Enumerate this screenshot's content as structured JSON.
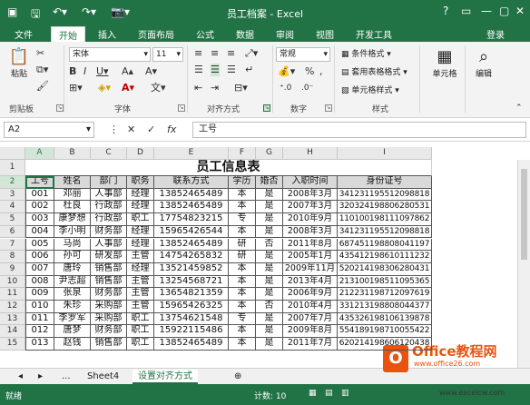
{
  "window": {
    "title": "员工档案 - Excel"
  },
  "ribbon_tabs": [
    "文件",
    "开始",
    "插入",
    "页面布局",
    "公式",
    "数据",
    "审阅",
    "视图",
    "开发工具"
  ],
  "user": "登录",
  "clipboard": {
    "paste": "粘贴",
    "label": "剪贴板"
  },
  "font": {
    "name": "宋体",
    "size": "11",
    "label": "字体"
  },
  "alignment": {
    "label": "对齐方式"
  },
  "number": {
    "format": "常规",
    "label": "数字",
    "percent": "%"
  },
  "styles": {
    "conditional": "条件格式",
    "table": "套用表格格式",
    "cell": "单元格样式",
    "label": "样式"
  },
  "cells_group": {
    "label": "单元格"
  },
  "editing": {
    "label": "编辑"
  },
  "formula_bar": {
    "name_box": "A2",
    "fx": "fx",
    "content": "工号"
  },
  "columns": [
    "A",
    "B",
    "C",
    "D",
    "E",
    "F",
    "G",
    "H",
    "I"
  ],
  "sheet_title": "员工信息表",
  "headers": [
    "工号",
    "姓名",
    "部门",
    "职务",
    "联系方式",
    "学历",
    "婚否",
    "入职时间",
    "身份证号"
  ],
  "rows": [
    [
      "001",
      "邓丽",
      "人事部",
      "经理",
      "13852465489",
      "本",
      "是",
      "2008年3月",
      "341231195512098818"
    ],
    [
      "002",
      "杜良",
      "行政部",
      "经理",
      "13852465489",
      "本",
      "是",
      "2007年3月",
      "320324198806280531"
    ],
    [
      "003",
      "康梦想",
      "行政部",
      "职工",
      "17754823215",
      "专",
      "是",
      "2010年9月",
      "110100198111097862"
    ],
    [
      "004",
      "李小明",
      "财务部",
      "经理",
      "15965426544",
      "本",
      "是",
      "2008年3月",
      "341231195512098818"
    ],
    [
      "005",
      "马尚",
      "人事部",
      "经理",
      "13852465489",
      "研",
      "否",
      "2011年8月",
      "687451198808041197"
    ],
    [
      "006",
      "孙可",
      "研发部",
      "主管",
      "14754265832",
      "研",
      "是",
      "2005年1月",
      "435412198610111232"
    ],
    [
      "007",
      "唐玲",
      "销售部",
      "经理",
      "13521459852",
      "本",
      "是",
      "2009年11月",
      "520214198306280431"
    ],
    [
      "008",
      "尹志超",
      "销售部",
      "主管",
      "13254568721",
      "本",
      "是",
      "2013年4月",
      "213100198511095365"
    ],
    [
      "009",
      "张泉",
      "财务部",
      "主管",
      "13654821359",
      "本",
      "是",
      "2006年9月",
      "212231198712097619"
    ],
    [
      "010",
      "朱珍",
      "采购部",
      "主管",
      "15965426325",
      "本",
      "否",
      "2010年4月",
      "331213198808044377"
    ],
    [
      "011",
      "李罗军",
      "采购部",
      "职工",
      "13754621548",
      "专",
      "是",
      "2007年7月",
      "435326198106139878"
    ],
    [
      "012",
      "唐梦",
      "财务部",
      "职工",
      "15922115486",
      "本",
      "是",
      "2009年8月",
      "554189198710055422"
    ],
    [
      "013",
      "赵钱",
      "销售部",
      "职工",
      "13852465489",
      "本",
      "是",
      "2011年7月",
      "620214198606120438"
    ]
  ],
  "row_numbers": [
    "1",
    "2",
    "3",
    "4",
    "5",
    "6",
    "7",
    "8",
    "9",
    "10",
    "11",
    "12",
    "13",
    "14",
    "15"
  ],
  "sheet_tabs": {
    "ellipsis": "...",
    "prev": "Sheet4",
    "active": "设置对齐方式"
  },
  "status": {
    "ready": "就绪",
    "count": "计数: 10"
  },
  "watermark": {
    "brand": "Office教程网",
    "url": "www.office26.com",
    "site": "www.excelcw.com"
  },
  "colors": {
    "accent": "#217346"
  }
}
